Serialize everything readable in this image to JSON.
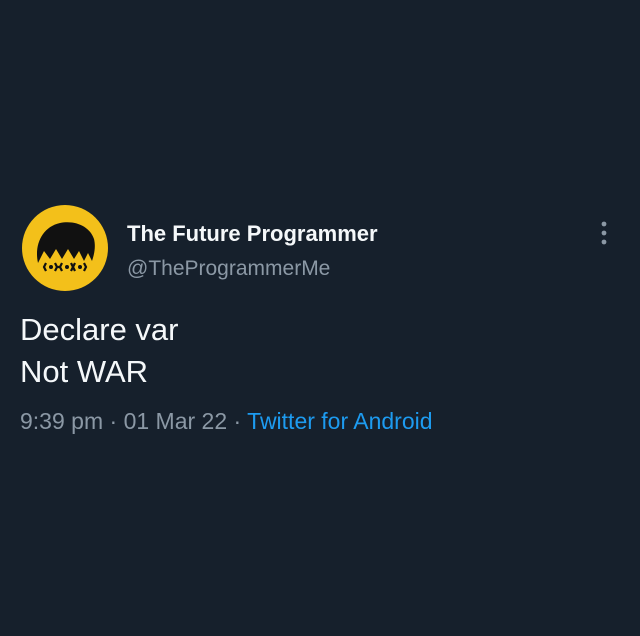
{
  "tweet": {
    "author": {
      "display_name": "The Future Programmer",
      "handle": "@TheProgrammerMe"
    },
    "text_lines": [
      "Declare var",
      "Not WAR"
    ],
    "time": "9:39 pm",
    "separator": "·",
    "date": "01 Mar 22",
    "source": "Twitter for Android",
    "more_icon": "more-vertical-icon"
  },
  "colors": {
    "background": "#16202c",
    "primary_text": "#f5f8fa",
    "secondary_text": "#8b98a5",
    "link": "#1d9bf0",
    "avatar_bg": "#f3c01a"
  }
}
